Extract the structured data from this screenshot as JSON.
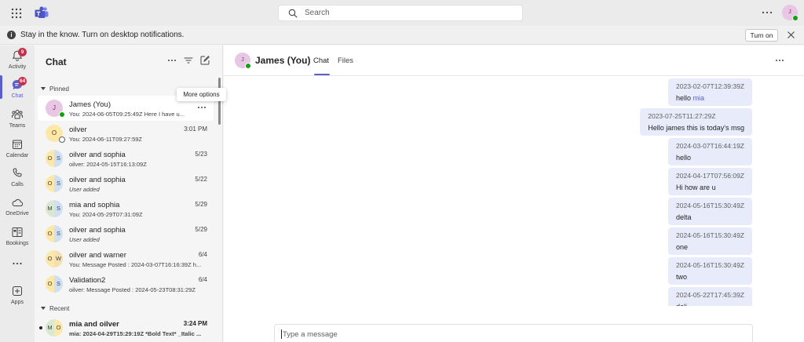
{
  "titlebar": {
    "search_placeholder": "Search",
    "user_initial": "J",
    "icons": [
      "waffle-icon",
      "teams-logo-icon",
      "search-icon",
      "more-icon"
    ]
  },
  "banner": {
    "text": "Stay in the know. Turn on desktop notifications.",
    "button_label": "Turn on"
  },
  "rail": {
    "items": [
      {
        "label": "Activity",
        "icon": "bell-icon",
        "badge": "9"
      },
      {
        "label": "Chat",
        "icon": "chat-icon",
        "badge": "64",
        "active": true
      },
      {
        "label": "Teams",
        "icon": "teams-icon"
      },
      {
        "label": "Calendar",
        "icon": "calendar-icon"
      },
      {
        "label": "Calls",
        "icon": "phone-icon"
      },
      {
        "label": "OneDrive",
        "icon": "cloud-icon"
      },
      {
        "label": "Bookings",
        "icon": "bookings-icon"
      },
      {
        "label": "Apps",
        "icon": "add-apps-icon"
      }
    ]
  },
  "chat_list": {
    "title": "Chat",
    "pinned_label": "Pinned",
    "recent_label": "Recent",
    "tooltip": "More options",
    "pinned": [
      {
        "name": "James (You)",
        "initials": "J",
        "preview": "You: 2024-06-05T09:25:49Z Here I have u...",
        "time": ""
      },
      {
        "name": "oilver",
        "initials": "O",
        "preview": "You: 2024-06-11T09:27:59Z",
        "time": "3:01 PM"
      },
      {
        "name": "oilver and sophia",
        "initials_left": "O",
        "initials_right": "S",
        "preview": "oilver: 2024-05-15T16:13:09Z",
        "time": "5/23"
      },
      {
        "name": "oilver and sophia",
        "initials_left": "O",
        "initials_right": "S",
        "preview": "User added",
        "time": "5/22"
      },
      {
        "name": "mia and sophia",
        "initials_left": "M",
        "initials_right": "S",
        "preview": "You: 2024-05-29T07:31:09Z",
        "time": "5/29"
      },
      {
        "name": "oilver and sophia",
        "initials_left": "O",
        "initials_right": "S",
        "preview": "User added",
        "time": "5/29"
      },
      {
        "name": "oilver and warner",
        "initials_left": "O",
        "initials_right": "W",
        "preview": "You: Message Posted : 2024-03-07T16:16:39Z h...",
        "time": "6/4"
      },
      {
        "name": "Validation2",
        "initials_left": "O",
        "initials_right": "S",
        "preview": "oilver: Message Posted : 2024-05-23T08:31:29Z",
        "time": "6/4"
      }
    ],
    "recent": [
      {
        "name": "mia and oilver",
        "initials_left": "M",
        "initials_right": "O",
        "preview": "mia: 2024-04-29T15:29:19Z *Bold Text* _Italic ...",
        "time": "3:24 PM"
      }
    ]
  },
  "conversation": {
    "name": "James (You)",
    "initial": "J",
    "tabs": [
      "Chat",
      "Files"
    ],
    "active_tab": "Chat",
    "messages": [
      {
        "timestamp": "2023-02-07T12:39:39Z",
        "text": "hello ",
        "mention": "mia"
      },
      {
        "timestamp": "2023-07-25T11:27:29Z",
        "text": "Hello james this is today's msg"
      },
      {
        "timestamp": "2024-03-07T16:44:19Z",
        "text": "hello"
      },
      {
        "timestamp": "2024-04-17T07:56:09Z",
        "text": "Hi how are u"
      },
      {
        "timestamp": "2024-05-16T15:30:49Z",
        "text": "delta"
      },
      {
        "timestamp": "2024-05-16T15:30:49Z",
        "text": "one"
      },
      {
        "timestamp": "2024-05-16T15:30:49Z",
        "text": "two"
      },
      {
        "timestamp": "2024-05-22T17:45:39Z",
        "text": "deli"
      }
    ],
    "compose_placeholder": "Type a message"
  },
  "colors": {
    "accent": "#5b5fc7",
    "badge": "#c4314b",
    "presence_available": "#13a10e",
    "bubble_self": "#e8ebfa"
  }
}
